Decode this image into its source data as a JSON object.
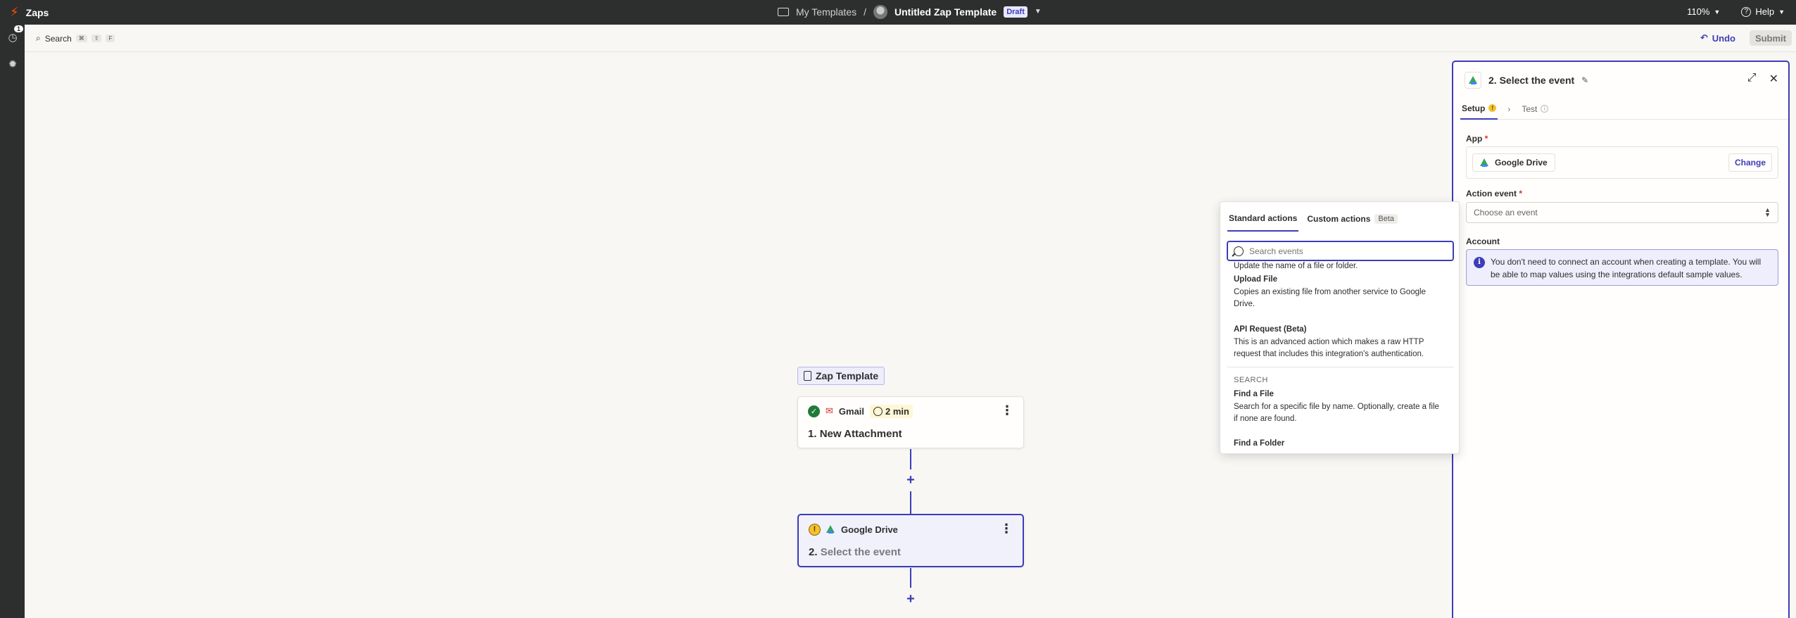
{
  "topbar": {
    "app_title": "Zaps",
    "folder": "My Templates",
    "separator": "/",
    "zap_title": "Untitled Zap Template",
    "status_badge": "Draft",
    "zoom": "110%",
    "help": "Help"
  },
  "rail": {
    "notification_count": "1"
  },
  "toolbar": {
    "search_label": "Search",
    "shortcut_keys": [
      "⌘",
      "⇧",
      "F"
    ],
    "undo_label": "Undo",
    "submit_label": "Submit"
  },
  "canvas": {
    "template_label": "Zap Template",
    "steps": [
      {
        "app": "Gmail",
        "time": "2 min",
        "number": "1.",
        "name": "New Attachment",
        "status": "complete"
      },
      {
        "app": "Google Drive",
        "number": "2.",
        "name": "Select the event",
        "status": "warning"
      }
    ]
  },
  "panel": {
    "title": "2. Select the event",
    "tabs": [
      {
        "label": "Setup"
      },
      {
        "label": "Test"
      }
    ],
    "app_label": "App",
    "app_value": "Google Drive",
    "change_label": "Change",
    "action_event_label": "Action event",
    "action_event_placeholder": "Choose an event",
    "account_label": "Account",
    "account_info": "You don't need to connect an account when creating a template. You will be able to map values using the integrations default sample values."
  },
  "dropdown": {
    "tab_standard": "Standard actions",
    "tab_custom": "Custom actions",
    "beta_badge": "Beta",
    "search_placeholder": "Search events",
    "clipped_top_desc": "Update the name of a file or folder.",
    "events": [
      {
        "title": "Upload File",
        "desc": "Copies an existing file from another service to Google Drive."
      },
      {
        "title": "API Request (Beta)",
        "desc": "This is an advanced action which makes a raw HTTP request that includes this integration's authentication."
      }
    ],
    "section_search": "SEARCH",
    "search_events": [
      {
        "title": "Find a File",
        "desc": "Search for a specific file by name. Optionally, create a file if none are found."
      },
      {
        "title": "Find a Folder"
      }
    ]
  },
  "colors": {
    "accent": "#3d3db8",
    "brand": "#ff4f00",
    "topbar_bg": "#2d2e2e",
    "canvas_bg": "#f8f7f4"
  }
}
